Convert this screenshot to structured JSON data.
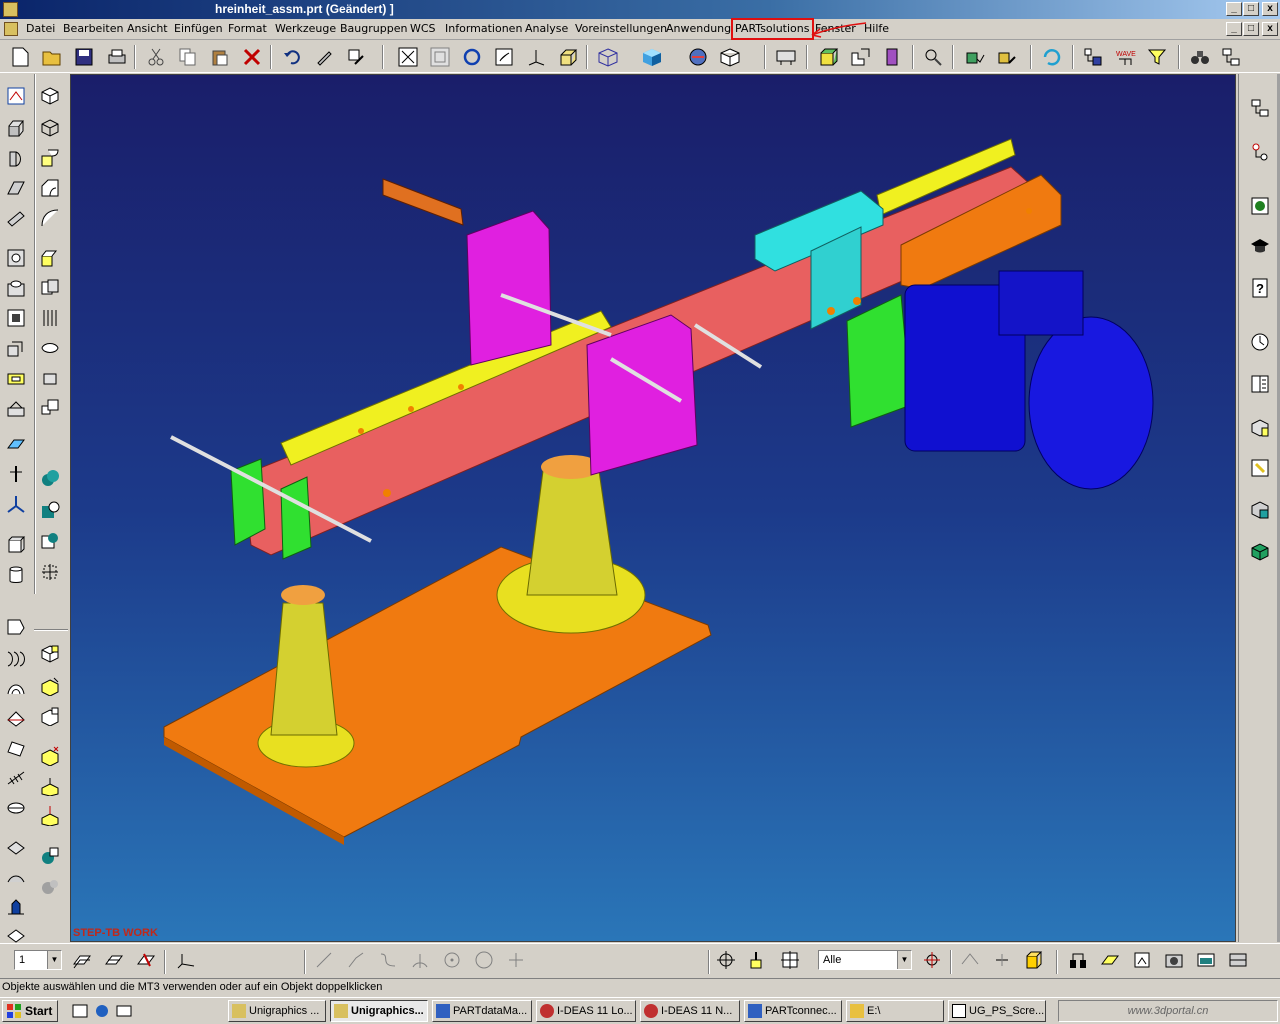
{
  "window": {
    "title": "hreinheit_assm.prt (Geändert) ]",
    "controls": [
      "_",
      "□",
      "x"
    ]
  },
  "menu": {
    "items": [
      "Datei",
      "Bearbeiten",
      "Ansicht",
      "Einfügen",
      "Format",
      "Werkzeuge",
      "Baugruppen",
      "WCS",
      "Informationen",
      "Analyse",
      "Voreinstellungen",
      "Anwendung",
      "PARTsolutions",
      "Fenster",
      "Hilfe"
    ],
    "highlighted": "PARTsolutions",
    "highlight_color": "#e01010"
  },
  "viewport": {
    "label": "STEP-TB WORK",
    "bg_top": "#1a1e6a",
    "bg_bottom": "#2a76b8"
  },
  "bottom_toolbar": {
    "layer_value": "1",
    "filter_value": "Alle"
  },
  "status": {
    "text": "Objekte auswählen und die MT3 verwenden oder auf ein Objekt doppelklicken"
  },
  "taskbar": {
    "start_label": "Start",
    "tasks": [
      "Unigraphics ...",
      "Unigraphics...",
      "PARTdataMa...",
      "I-DEAS 11 Lo...",
      "I-DEAS 11 N...",
      "PARTconnec...",
      "E:\\",
      "UG_PS_Scre..."
    ],
    "active_index": 1,
    "watermark": "www.3dportal.cn"
  },
  "icons": {
    "toolbar": [
      "new-icon",
      "open-icon",
      "save-icon",
      "print-icon",
      "cut-icon",
      "copy-icon",
      "paste-icon",
      "delete-icon",
      "undo-icon",
      "edit-icon",
      "edit-object-icon",
      "fit-icon",
      "zoom-icon",
      "rotate-icon",
      "pan-icon",
      "orient-icon",
      "perspective-icon",
      "wireframe-icon",
      "shaded-icon",
      "shaded-edge-icon",
      "hidden-icon",
      "layer-icon",
      "part-icon",
      "assembly-icon",
      "door-icon",
      "point-icon",
      "cube-check-icon",
      "cube-edit-icon",
      "refresh-icon",
      "nav-icon",
      "wave-icon",
      "filter-icon",
      "binoculars-icon",
      "tree-icon"
    ]
  }
}
